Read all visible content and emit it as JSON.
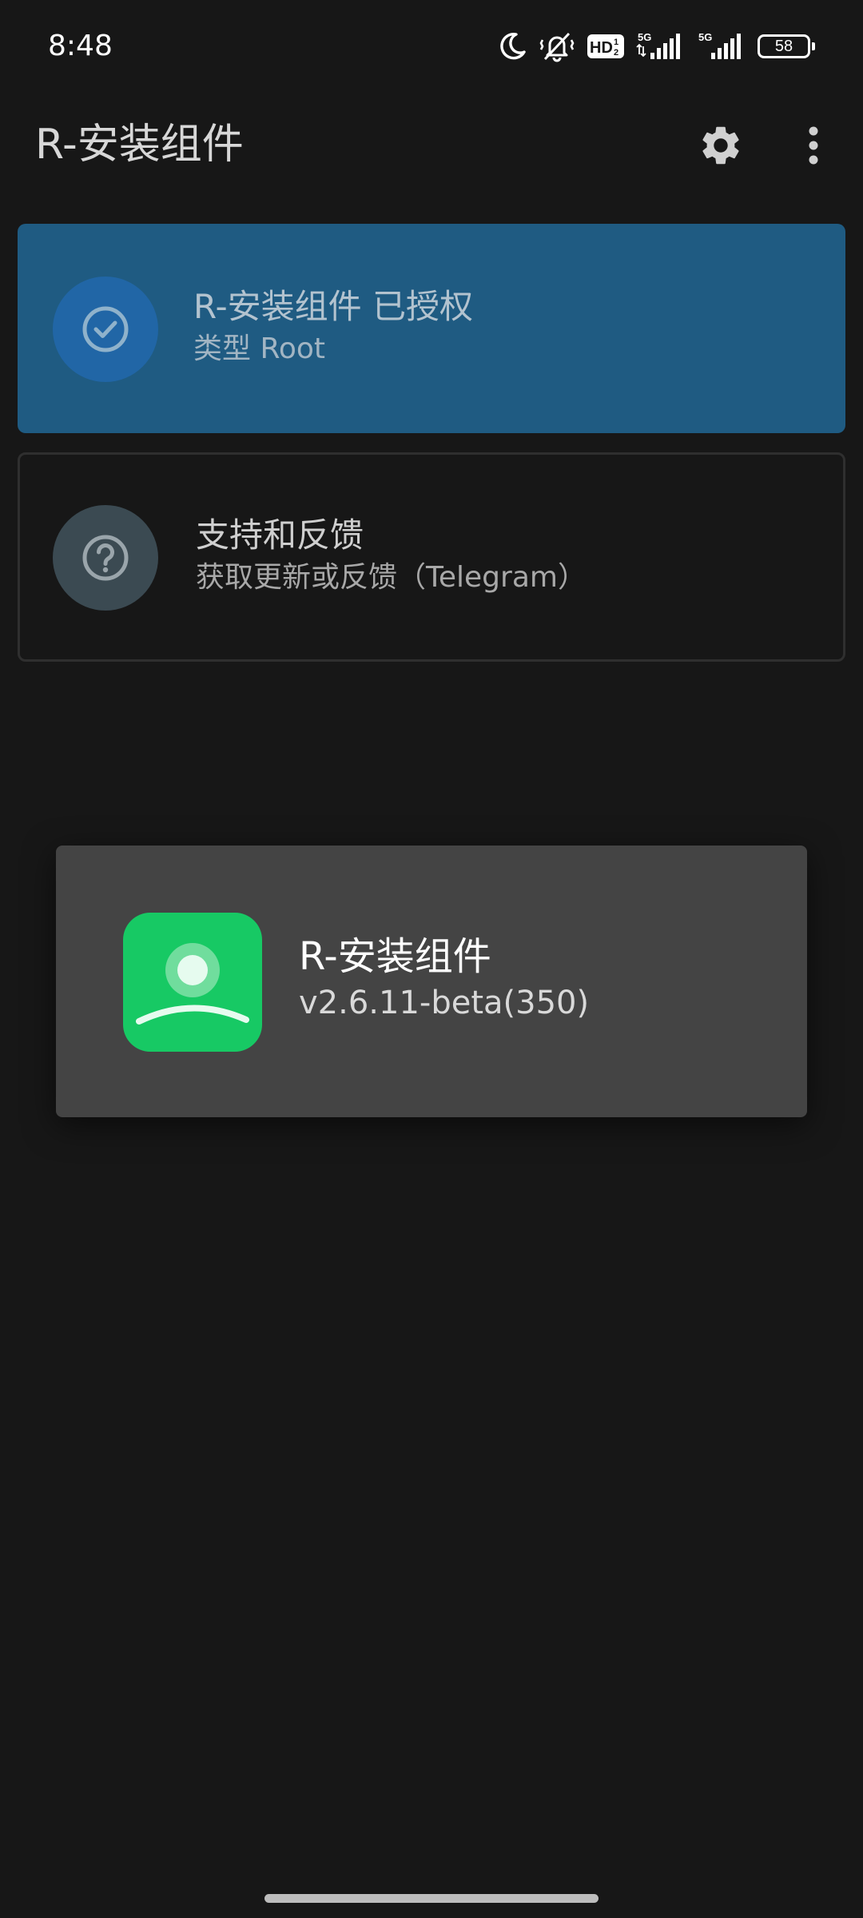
{
  "status_bar": {
    "time": "8:48",
    "hd_badge": "HD",
    "hd_sub": "1",
    "hd_sub2": "2",
    "signal1_label": "5G",
    "signal2_label": "5G",
    "battery_level": "58",
    "icons": [
      "moon-icon",
      "vibrate-off-icon",
      "hd-voice-icon",
      "signal-icon",
      "signal-icon",
      "battery-icon"
    ]
  },
  "app_bar": {
    "title": "R-安装组件",
    "icons": [
      "gear-icon",
      "more-vertical-icon"
    ]
  },
  "status_card": {
    "title": "R-安装组件 已授权",
    "subtitle": "类型 Root",
    "icon": "check-circle-icon",
    "color": "#1f5b82"
  },
  "support_card": {
    "title": "支持和反馈",
    "subtitle": "获取更新或反馈（Telegram）",
    "icon": "help-circle-icon"
  },
  "app_popup": {
    "app_name": "R-安装组件",
    "version": "v2.6.11-beta(350)",
    "icon": "app-logo-icon",
    "icon_color": "#17c964"
  }
}
